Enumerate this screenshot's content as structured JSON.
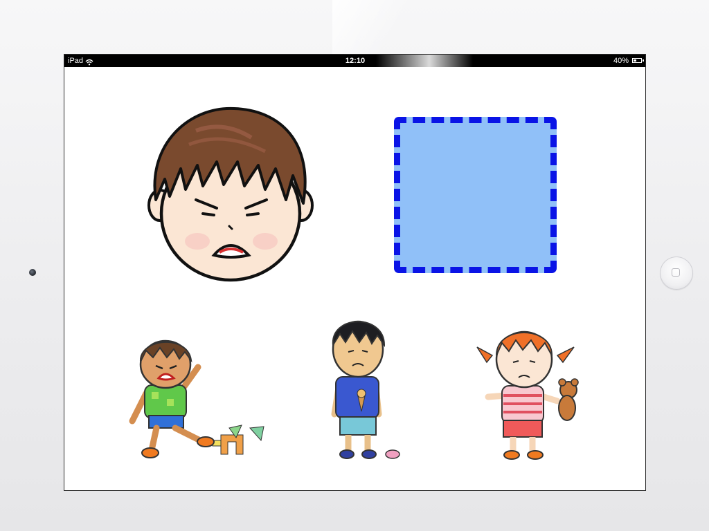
{
  "status_bar": {
    "carrier": "iPad",
    "time": "12:10",
    "battery": "40%",
    "battery_level": 0.4
  },
  "icons": {
    "wifi": "wifi-icon",
    "battery": "battery-icon",
    "home": "home-button-icon"
  },
  "colors": {
    "drop_zone_fill": "#90c0f8",
    "drop_zone_border": "#0a14e6",
    "screen_background": "#ffffff"
  },
  "prompt_image": {
    "name": "angry-boy-face"
  },
  "drop_zone": {
    "name": "answer-drop-target"
  },
  "choices": [
    {
      "name": "angry-boy-kicking-blocks"
    },
    {
      "name": "sad-boy-dropped-ice-cream"
    },
    {
      "name": "sad-girl-holding-teddy-bear"
    }
  ]
}
